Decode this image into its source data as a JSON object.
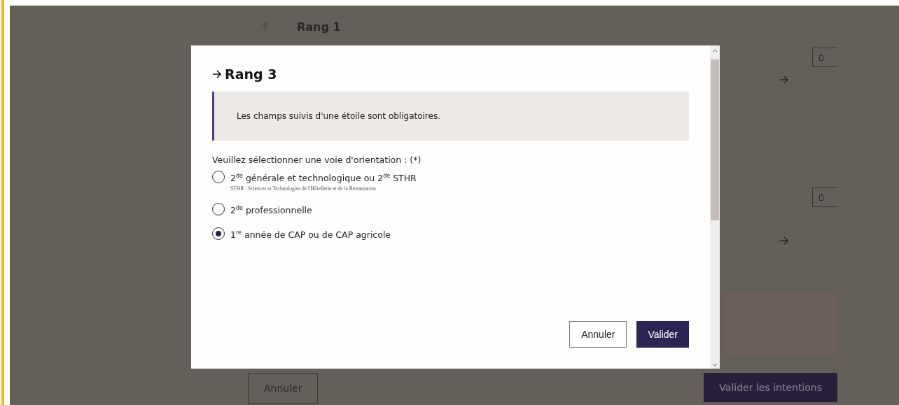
{
  "background": {
    "rank_title": "Rang 1",
    "cancel_button": "Annuler",
    "submit_button": "Valider les intentions"
  },
  "dialog": {
    "title": "Rang 3",
    "notice": "Les champs suivis d'une étoile sont obligatoires.",
    "question": "Veuillez sélectionner une voie d'orientation : (*)",
    "options": [
      {
        "label": "2$^{de}$ générale et technologique ou 2$^{de}$ STHR",
        "note": "STHR : Sciences et Technologies de l'Hôtellerie et de la Restauration",
        "selected": false
      },
      {
        "label": "2$^{de}$ professionnelle",
        "selected": false
      },
      {
        "label": "1$^{re}$ année de CAP ou de CAP agricole",
        "selected": true
      }
    ],
    "buttons": [
      {
        "label": "Annuler",
        "kind": "secondary"
      },
      {
        "label": "Valider",
        "kind": "primary"
      }
    ]
  }
}
